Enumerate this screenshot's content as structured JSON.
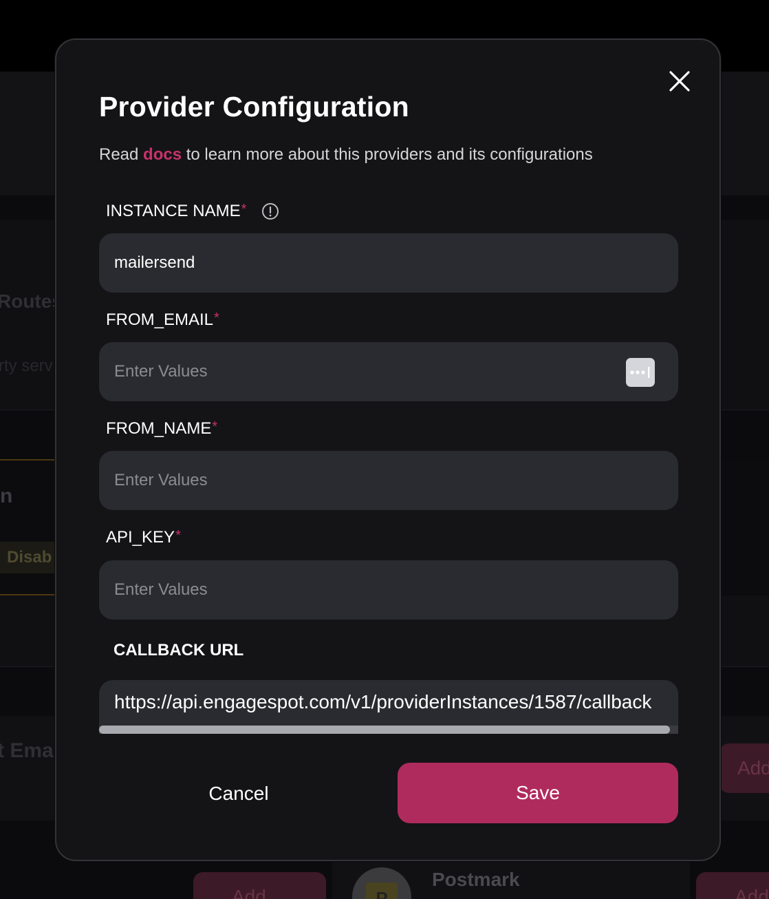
{
  "background": {
    "routes_title": "Routes",
    "routes_subtitle": "rty serv",
    "section_letter": "n",
    "status_badge": "Disab",
    "email_title": "t Ema",
    "add_label": "Add",
    "provider_name": "Postmark",
    "provider_initial": "P"
  },
  "modal": {
    "title": "Provider Configuration",
    "description_prefix": "Read ",
    "description_link": "docs",
    "description_suffix": " to learn more about this providers and its configurations",
    "close_icon": "close-icon",
    "fields": {
      "instance_name": {
        "label": "INSTANCE NAME",
        "required": "*",
        "value": "mailersend",
        "info_icon": "info-circle-icon"
      },
      "from_email": {
        "label": "FROM_EMAIL",
        "required": "*",
        "placeholder": "Enter Values",
        "autofill_icon": "password-manager-icon"
      },
      "from_name": {
        "label": "FROM_NAME",
        "required": "*",
        "placeholder": "Enter Values"
      },
      "api_key": {
        "label": "API_KEY",
        "required": "*",
        "placeholder": "Enter Values"
      }
    },
    "callback": {
      "label": "CALLBACK URL",
      "url": "https://api.engagespot.com/v1/providerInstances/1587/callback"
    },
    "buttons": {
      "cancel": "Cancel",
      "save": "Save"
    }
  },
  "colors": {
    "accent": "#c7336a",
    "save_button": "#b02b5d",
    "modal_background": "#141416",
    "field_background": "#2a2b30"
  }
}
